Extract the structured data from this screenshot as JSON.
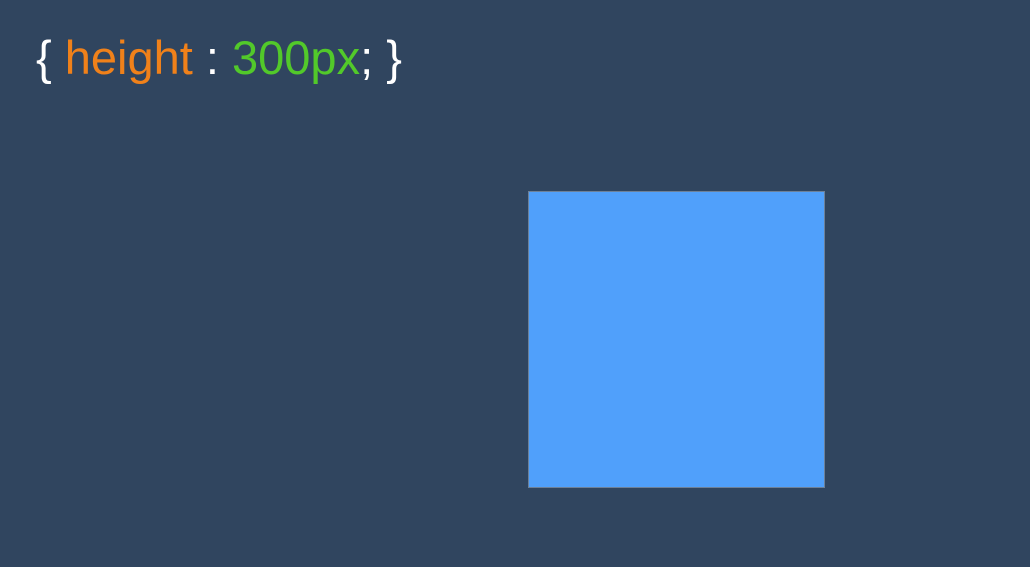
{
  "css_snippet": {
    "open_brace": "{",
    "property": "height",
    "colon": ":",
    "value": "300px",
    "semicolon": ";",
    "close_brace": "}"
  },
  "colors": {
    "background": "#30455f",
    "brace": "#ffffff",
    "property": "#f0811a",
    "value": "#52c92a",
    "box_fill": "#50a0fb"
  }
}
